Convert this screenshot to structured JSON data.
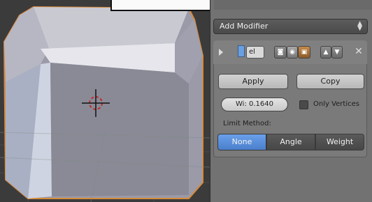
{
  "modifiers_panel": {
    "add_modifier_label": "Add Modifier",
    "modifier": {
      "name": "el",
      "apply_label": "Apply",
      "copy_label": "Copy",
      "width_value": "Wi: 0.1640",
      "only_vertices_label": "Only Vertices",
      "limit_method_label": "Limit Method:",
      "limit_methods": [
        "None",
        "Angle",
        "Weight"
      ],
      "limit_method_selected": "None"
    }
  },
  "colors": {
    "selected_accent": "#5a8fdc",
    "object_outline": "#e08a3a",
    "viewport_bg": "#3b3b3b",
    "panel_bg": "#727272"
  }
}
